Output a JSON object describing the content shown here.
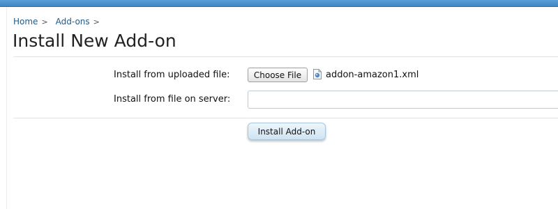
{
  "breadcrumb": {
    "items": [
      {
        "label": "Home"
      },
      {
        "label": "Add-ons"
      }
    ],
    "separator": ">"
  },
  "page": {
    "title": "Install New Add-on"
  },
  "form": {
    "upload": {
      "label": "Install from uploaded file:",
      "button_label": "Choose File",
      "file_icon": "file-icon",
      "file_name": "addon-amazon1.xml"
    },
    "server": {
      "label": "Install from file on server:",
      "value": "",
      "placeholder": ""
    },
    "submit_label": "Install Add-on"
  },
  "colors": {
    "top_bar": "#3f86c4",
    "link": "#1d5a8a",
    "rule": "#d8e6ef",
    "button_top": "#eef6fc",
    "button_bottom": "#cfe3f2"
  }
}
